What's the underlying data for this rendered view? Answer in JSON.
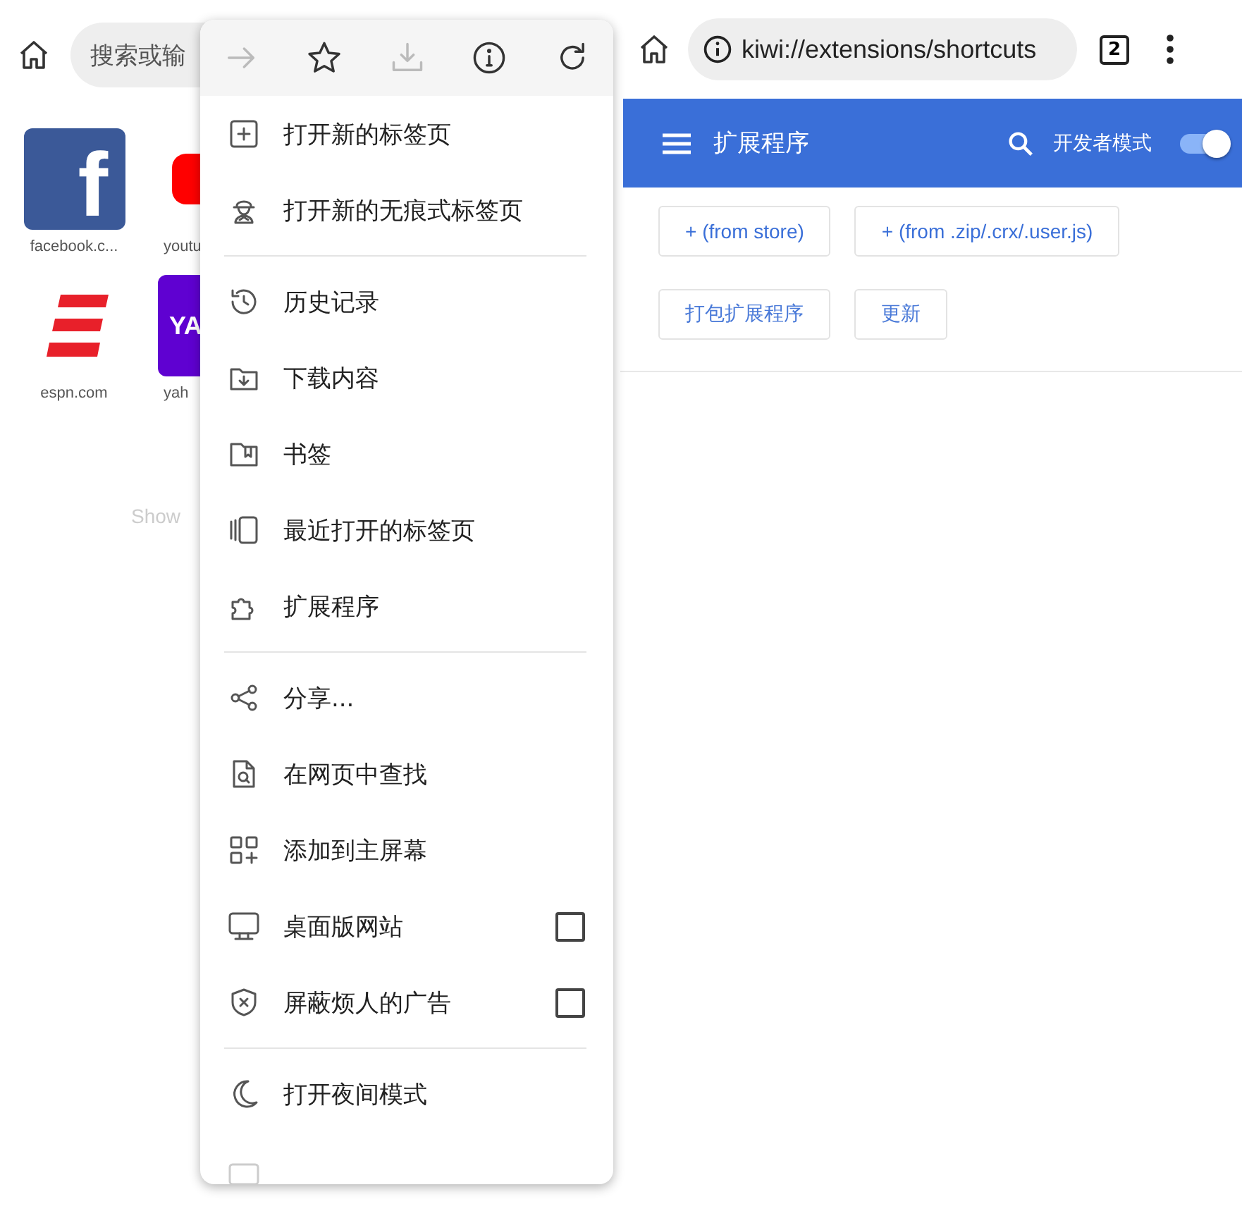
{
  "left_screen": {
    "search": {
      "placeholder": "搜索或输"
    },
    "tiles": [
      {
        "kind": "facebook",
        "logo": "f",
        "label": "facebook.c..."
      },
      {
        "kind": "youtube",
        "label": "youtu"
      },
      {
        "kind": "espn",
        "label": "espn.com"
      },
      {
        "kind": "yahoo",
        "logo": "YA",
        "label": "yah"
      }
    ],
    "more_link": "Show"
  },
  "menu": {
    "toolbar": [
      {
        "kind": "forward",
        "disabled": true
      },
      {
        "kind": "star",
        "disabled": false
      },
      {
        "kind": "download",
        "disabled": true
      },
      {
        "kind": "info",
        "disabled": false
      },
      {
        "kind": "reload",
        "disabled": false
      }
    ],
    "groups": [
      [
        {
          "kind": "item",
          "label": "打开新的标签页"
        },
        {
          "kind": "item",
          "label": "打开新的无痕式标签页"
        }
      ],
      [
        {
          "kind": "item",
          "label": "历史记录"
        },
        {
          "kind": "item",
          "label": "下载内容"
        },
        {
          "kind": "item",
          "label": "书签"
        },
        {
          "kind": "item",
          "label": "最近打开的标签页"
        },
        {
          "kind": "item",
          "label": "扩展程序"
        }
      ],
      [
        {
          "kind": "item",
          "label": "分享..."
        },
        {
          "kind": "item",
          "label": "在网页中查找"
        },
        {
          "kind": "item",
          "label": "添加到主屏幕"
        },
        {
          "kind": "checkbox",
          "label": "桌面版网站",
          "checked": false
        },
        {
          "kind": "checkbox",
          "label": "屏蔽烦人的广告",
          "checked": false
        }
      ],
      [
        {
          "kind": "item",
          "label": "打开夜间模式"
        }
      ]
    ]
  },
  "right_screen": {
    "url": "kiwi://extensions/shortcuts",
    "tab_count": "2",
    "header": {
      "title": "扩展程序",
      "developer_mode_label": "开发者模式",
      "developer_mode_on": true
    },
    "button_rows": [
      [
        "+ (from store)",
        "+ (from .zip/.crx/.user.js)"
      ],
      [
        "打包扩展程序",
        "更新"
      ]
    ]
  }
}
